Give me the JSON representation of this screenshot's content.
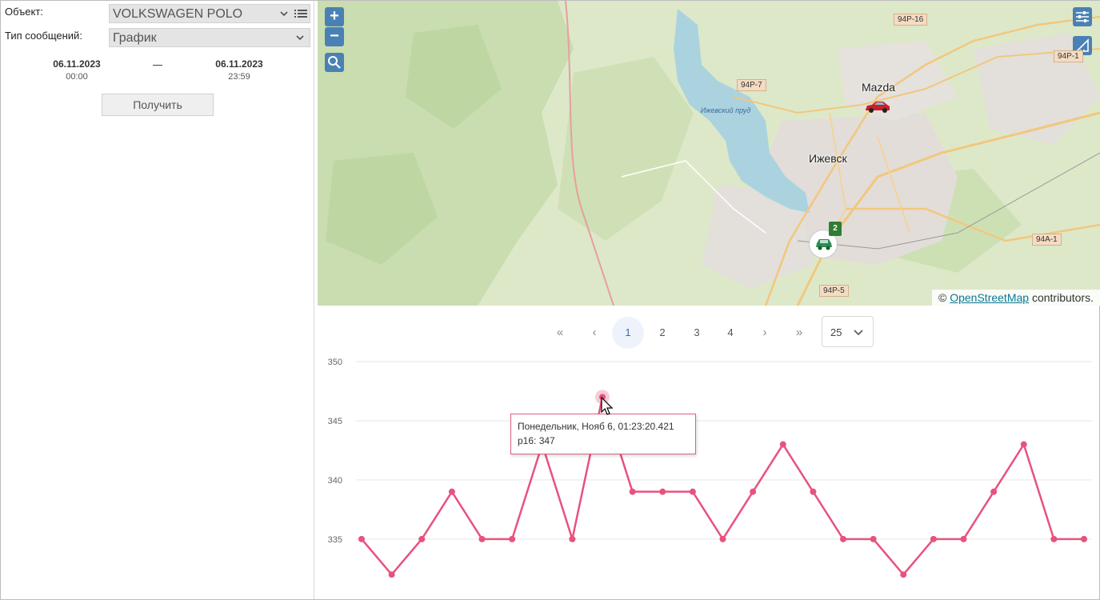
{
  "left_panel": {
    "object_label": "Объект:",
    "object_value": "VOLKSWAGEN POLO",
    "msg_type_label": "Тип сообщений:",
    "msg_type_value": "График",
    "from_date": "06.11.2023",
    "from_time": "00:00",
    "to_date": "06.11.2023",
    "to_time": "23:59",
    "get_button": "Получить"
  },
  "map": {
    "zoom_in": "+",
    "zoom_out": "−",
    "city": "Ижевск",
    "lake": "Ижевский пруд",
    "roads": [
      "94Р-16",
      "94Р-7",
      "94Р-1",
      "94А-1",
      "94Р-5"
    ],
    "vehicle_label": "Mazda",
    "cluster_count": "2",
    "attribution_prefix": "©",
    "attribution_link": "OpenStreetMap",
    "attribution_suffix": "contributors.",
    "icons": [
      "zoom-in-icon",
      "zoom-out-icon",
      "search-icon",
      "settings-sliders-icon",
      "ruler-icon",
      "car-icon"
    ]
  },
  "pagination": {
    "first": "«",
    "prev": "‹",
    "pages": [
      "1",
      "2",
      "3",
      "4"
    ],
    "active_page": "1",
    "next": "›",
    "last": "»",
    "per_page": "25"
  },
  "tooltip": {
    "line1": "Понедельник, Нояб 6, 01:23:20.421",
    "line2": "p16: 347"
  },
  "chart_data": {
    "type": "line",
    "series": [
      {
        "name": "p16",
        "color": "#e8527e",
        "values": [
          335,
          332,
          335,
          339,
          335,
          335,
          343,
          335,
          347,
          339,
          339,
          339,
          335,
          339,
          343,
          339,
          335,
          335,
          332,
          335,
          335,
          339,
          343,
          335,
          335
        ]
      }
    ],
    "highlighted_index": 8,
    "yticks": [
      335,
      340,
      345,
      350
    ],
    "ylim": [
      331,
      350
    ],
    "grid": true
  }
}
